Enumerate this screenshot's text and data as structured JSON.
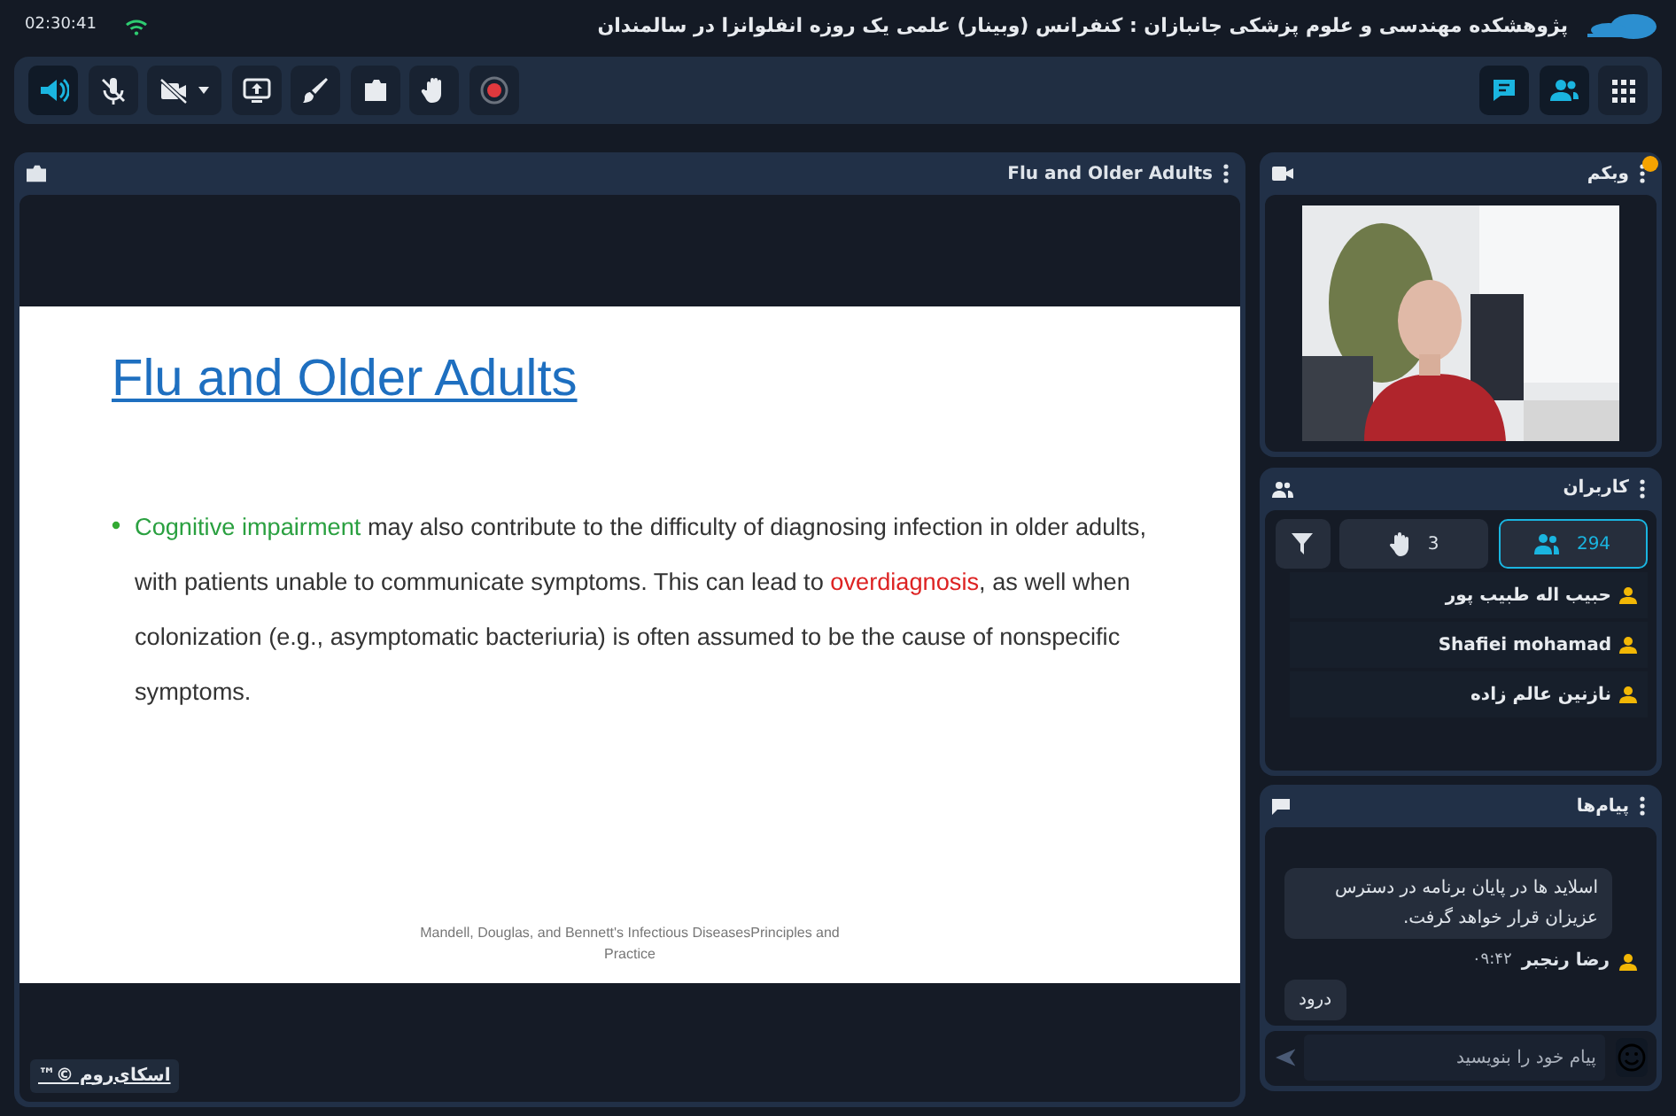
{
  "header": {
    "title": "پژوهشکده مهندسی و علوم پزشکی جانبازان : کنفرانس (وبینار) علمی یک روزه انفلوانزا در سالمندان",
    "clock": "02:30:41"
  },
  "toolbar": {
    "left": [
      {
        "active": true
      },
      {
        "active": false
      },
      {
        "active": false,
        "dropdown": true
      },
      {
        "active": false
      },
      {
        "active": false
      },
      {
        "active": false
      },
      {
        "active": false
      },
      {
        "active": false
      }
    ],
    "right": [
      {
        "active": true
      },
      {
        "active": true
      },
      {
        "active": false
      }
    ]
  },
  "presentation": {
    "title": "Flu and Older Adults",
    "slide": {
      "heading": "Flu and Older Adults",
      "bullet": [
        {
          "kind": "term",
          "text": "Cognitive impairment"
        },
        {
          "kind": "plain",
          "text": " may also contribute to the difficulty of diagnosing infection in older adults, with patients unable to communicate symptoms. This can lead to "
        },
        {
          "kind": "alert",
          "text": "overdiagnosis"
        },
        {
          "kind": "plain",
          "text": ", as well when colonization (e.g., asymptomatic bacteriuria) is often assumed to be the cause of  nonspecific symptoms."
        }
      ],
      "footnote": "Mandell, Douglas, and Bennett's Infectious DiseasesPrinciples and Practice"
    },
    "brand": "اسکای‌روم ©™"
  },
  "webcam": {
    "title": "وبکم",
    "notification": true
  },
  "users": {
    "title": "کاربران",
    "tabs": [
      {
        "label": "294",
        "selected": true
      },
      {
        "label": "3",
        "selected": false
      }
    ],
    "list": [
      {
        "name": "حبیب اله طبیب پور"
      },
      {
        "name": "Shafiei mohamad"
      },
      {
        "name": "نازنین عالم زاده"
      }
    ]
  },
  "chat": {
    "title": "پیام‌ها",
    "messages": [
      {
        "text": "اسلاید ها در پایان برنامه در دسترس عزیزان قرار خواهد گرفت."
      },
      {
        "sender": "رضا رنجبر",
        "time": "۰۹:۴۲",
        "text": "درود"
      }
    ],
    "input": {
      "placeholder": "پیام خود را بنویسید"
    }
  }
}
